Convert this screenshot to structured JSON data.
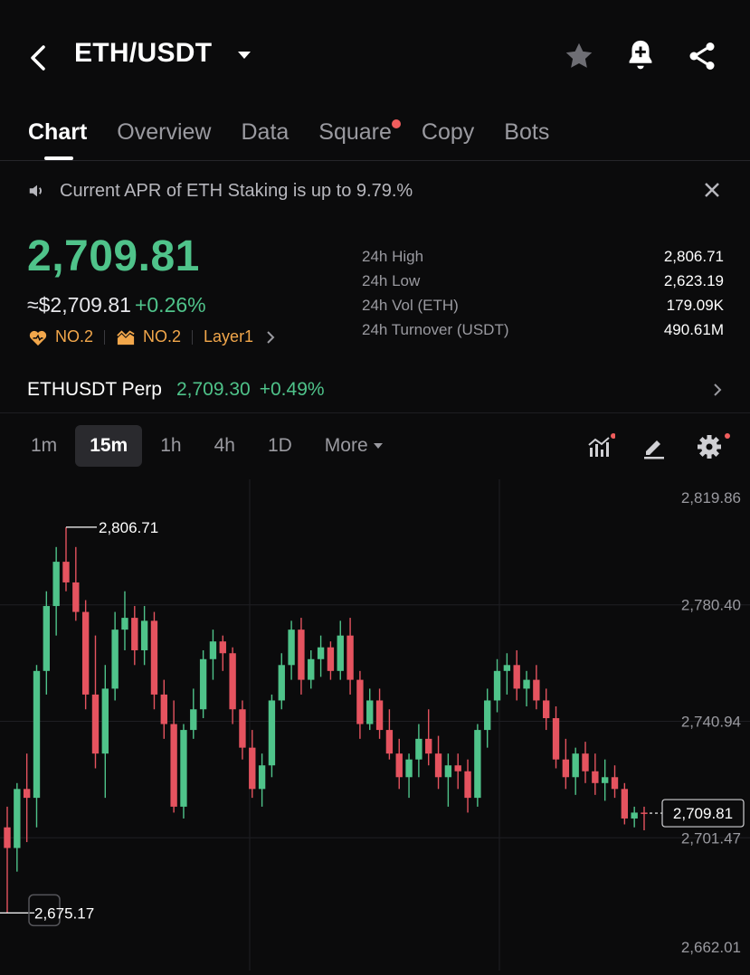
{
  "header": {
    "pair": "ETH/USDT",
    "icons": [
      "back-arrow-icon",
      "chevron-down-icon",
      "star-icon",
      "bell-plus-icon",
      "share-icon"
    ]
  },
  "tabs": [
    "Chart",
    "Overview",
    "Data",
    "Square",
    "Copy",
    "Bots"
  ],
  "active_tab": "Chart",
  "notice": {
    "text": "Current APR of ETH Staking is up to 9.79.%"
  },
  "price": {
    "last": "2,709.81",
    "usd": "≈$2,709.81",
    "change": "+0.26%"
  },
  "tags": {
    "rank1": "NO.2",
    "rank2": "NO.2",
    "category": "Layer1"
  },
  "stats": [
    {
      "label": "24h High",
      "value": "2,806.71"
    },
    {
      "label": "24h Low",
      "value": "2,623.19"
    },
    {
      "label": "24h Vol (ETH)",
      "value": "179.09K"
    },
    {
      "label": "24h Turnover (USDT)",
      "value": "490.61M"
    }
  ],
  "perp": {
    "name": "ETHUSDT Perp",
    "price": "2,709.30",
    "change": "+0.49%"
  },
  "timeframes": [
    "1m",
    "15m",
    "1h",
    "4h",
    "1D",
    "More"
  ],
  "active_timeframe": "15m",
  "colors": {
    "up": "#4fc38a",
    "down": "#e5535f",
    "bg": "#0b0b0c",
    "accent_dot": "#f05d5d"
  },
  "chart_data": {
    "type": "candlestick",
    "y_ticks": [
      "2,819.86",
      "2,780.40",
      "2,740.94",
      "2,701.47",
      "2,662.01"
    ],
    "ylim": [
      2662.01,
      2819.86
    ],
    "high_label": "2,806.71",
    "low_label": "2,675.17",
    "last_price_label": "2,709.81",
    "candles": [
      {
        "o": 2705,
        "h": 2712,
        "l": 2676,
        "c": 2698
      },
      {
        "o": 2698,
        "h": 2720,
        "l": 2690,
        "c": 2718
      },
      {
        "o": 2718,
        "h": 2730,
        "l": 2700,
        "c": 2715
      },
      {
        "o": 2715,
        "h": 2760,
        "l": 2705,
        "c": 2758
      },
      {
        "o": 2758,
        "h": 2785,
        "l": 2750,
        "c": 2780
      },
      {
        "o": 2780,
        "h": 2800,
        "l": 2770,
        "c": 2795
      },
      {
        "o": 2795,
        "h": 2806.71,
        "l": 2785,
        "c": 2788
      },
      {
        "o": 2788,
        "h": 2800,
        "l": 2775,
        "c": 2778
      },
      {
        "o": 2778,
        "h": 2782,
        "l": 2745,
        "c": 2750
      },
      {
        "o": 2750,
        "h": 2770,
        "l": 2725,
        "c": 2730
      },
      {
        "o": 2730,
        "h": 2760,
        "l": 2715,
        "c": 2752
      },
      {
        "o": 2752,
        "h": 2778,
        "l": 2748,
        "c": 2772
      },
      {
        "o": 2772,
        "h": 2785,
        "l": 2765,
        "c": 2776
      },
      {
        "o": 2776,
        "h": 2780,
        "l": 2760,
        "c": 2765
      },
      {
        "o": 2765,
        "h": 2780,
        "l": 2760,
        "c": 2775
      },
      {
        "o": 2775,
        "h": 2778,
        "l": 2745,
        "c": 2750
      },
      {
        "o": 2750,
        "h": 2755,
        "l": 2735,
        "c": 2740
      },
      {
        "o": 2740,
        "h": 2748,
        "l": 2710,
        "c": 2712
      },
      {
        "o": 2712,
        "h": 2740,
        "l": 2708,
        "c": 2738
      },
      {
        "o": 2738,
        "h": 2752,
        "l": 2735,
        "c": 2745
      },
      {
        "o": 2745,
        "h": 2765,
        "l": 2742,
        "c": 2762
      },
      {
        "o": 2762,
        "h": 2772,
        "l": 2755,
        "c": 2768
      },
      {
        "o": 2768,
        "h": 2770,
        "l": 2758,
        "c": 2764
      },
      {
        "o": 2764,
        "h": 2766,
        "l": 2740,
        "c": 2745
      },
      {
        "o": 2745,
        "h": 2748,
        "l": 2728,
        "c": 2732
      },
      {
        "o": 2732,
        "h": 2738,
        "l": 2715,
        "c": 2718
      },
      {
        "o": 2718,
        "h": 2730,
        "l": 2712,
        "c": 2726
      },
      {
        "o": 2726,
        "h": 2750,
        "l": 2722,
        "c": 2748
      },
      {
        "o": 2748,
        "h": 2764,
        "l": 2745,
        "c": 2760
      },
      {
        "o": 2760,
        "h": 2775,
        "l": 2755,
        "c": 2772
      },
      {
        "o": 2772,
        "h": 2776,
        "l": 2750,
        "c": 2755
      },
      {
        "o": 2755,
        "h": 2765,
        "l": 2752,
        "c": 2762
      },
      {
        "o": 2762,
        "h": 2770,
        "l": 2756,
        "c": 2766
      },
      {
        "o": 2766,
        "h": 2768,
        "l": 2755,
        "c": 2758
      },
      {
        "o": 2758,
        "h": 2775,
        "l": 2755,
        "c": 2770
      },
      {
        "o": 2770,
        "h": 2776,
        "l": 2750,
        "c": 2755
      },
      {
        "o": 2755,
        "h": 2758,
        "l": 2735,
        "c": 2740
      },
      {
        "o": 2740,
        "h": 2752,
        "l": 2738,
        "c": 2748
      },
      {
        "o": 2748,
        "h": 2752,
        "l": 2735,
        "c": 2738
      },
      {
        "o": 2738,
        "h": 2745,
        "l": 2728,
        "c": 2730
      },
      {
        "o": 2730,
        "h": 2735,
        "l": 2718,
        "c": 2722
      },
      {
        "o": 2722,
        "h": 2730,
        "l": 2715,
        "c": 2728
      },
      {
        "o": 2728,
        "h": 2740,
        "l": 2722,
        "c": 2735
      },
      {
        "o": 2735,
        "h": 2745,
        "l": 2726,
        "c": 2730
      },
      {
        "o": 2730,
        "h": 2736,
        "l": 2718,
        "c": 2722
      },
      {
        "o": 2722,
        "h": 2730,
        "l": 2712,
        "c": 2726
      },
      {
        "o": 2726,
        "h": 2730,
        "l": 2718,
        "c": 2724
      },
      {
        "o": 2724,
        "h": 2728,
        "l": 2710,
        "c": 2715
      },
      {
        "o": 2715,
        "h": 2740,
        "l": 2712,
        "c": 2738
      },
      {
        "o": 2738,
        "h": 2752,
        "l": 2732,
        "c": 2748
      },
      {
        "o": 2748,
        "h": 2762,
        "l": 2744,
        "c": 2758
      },
      {
        "o": 2758,
        "h": 2764,
        "l": 2750,
        "c": 2760
      },
      {
        "o": 2760,
        "h": 2765,
        "l": 2748,
        "c": 2752
      },
      {
        "o": 2752,
        "h": 2758,
        "l": 2746,
        "c": 2755
      },
      {
        "o": 2755,
        "h": 2760,
        "l": 2745,
        "c": 2748
      },
      {
        "o": 2748,
        "h": 2752,
        "l": 2738,
        "c": 2742
      },
      {
        "o": 2742,
        "h": 2746,
        "l": 2725,
        "c": 2728
      },
      {
        "o": 2728,
        "h": 2735,
        "l": 2718,
        "c": 2722
      },
      {
        "o": 2722,
        "h": 2732,
        "l": 2716,
        "c": 2730
      },
      {
        "o": 2730,
        "h": 2734,
        "l": 2720,
        "c": 2724
      },
      {
        "o": 2724,
        "h": 2730,
        "l": 2716,
        "c": 2720
      },
      {
        "o": 2720,
        "h": 2728,
        "l": 2714,
        "c": 2722
      },
      {
        "o": 2722,
        "h": 2726,
        "l": 2715,
        "c": 2718
      },
      {
        "o": 2718,
        "h": 2720,
        "l": 2706,
        "c": 2708
      },
      {
        "o": 2708,
        "h": 2712,
        "l": 2705,
        "c": 2710
      },
      {
        "o": 2710,
        "h": 2712,
        "l": 2704,
        "c": 2709.81
      }
    ]
  }
}
